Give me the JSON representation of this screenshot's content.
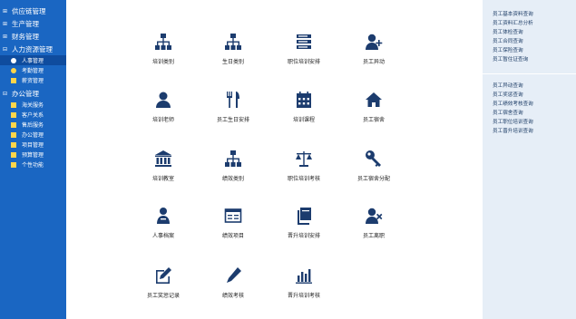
{
  "sidebar": {
    "top": [
      "供应链管理",
      "生产管理",
      "财务管理"
    ],
    "hr": {
      "label": "人力资源管理",
      "items": [
        "人事管理",
        "考勤管理",
        "薪资管理"
      ]
    },
    "office": {
      "label": "办公管理",
      "items": [
        "海关服务",
        "客户关系",
        "售后服务",
        "办公管理",
        "项目管理",
        "预算管理",
        "个性功能"
      ]
    }
  },
  "tiles": [
    {
      "label": "培训类别",
      "icon": "org-chart-icon"
    },
    {
      "label": "生日类别",
      "icon": "org-chart-icon"
    },
    {
      "label": "职位培训安排",
      "icon": "list-icon"
    },
    {
      "label": "员工异动",
      "icon": "user-add-icon"
    },
    {
      "label": "培训老师",
      "icon": "user-icon"
    },
    {
      "label": "员工生日安排",
      "icon": "cutlery-icon"
    },
    {
      "label": "培训课程",
      "icon": "calendar-icon"
    },
    {
      "label": "员工宿舍",
      "icon": "home-icon"
    },
    {
      "label": "培训教室",
      "icon": "bank-icon"
    },
    {
      "label": "绩效类别",
      "icon": "org-chart-icon"
    },
    {
      "label": "职位培训考核",
      "icon": "scale-icon"
    },
    {
      "label": "员工宿舍分配",
      "icon": "key-icon"
    },
    {
      "label": "人事档案",
      "icon": "archive-user-icon"
    },
    {
      "label": "绩效项目",
      "icon": "card-icon"
    },
    {
      "label": "晋升培训安排",
      "icon": "book-icon"
    },
    {
      "label": "员工离职",
      "icon": "user-remove-icon"
    },
    {
      "label": "员工奖惩记录",
      "icon": "edit-icon"
    },
    {
      "label": "绩效考核",
      "icon": "pencil-icon"
    },
    {
      "label": "晋升培训考核",
      "icon": "bar-chart-icon"
    }
  ],
  "right_panel": {
    "group1": [
      "员工基本资料查询",
      "员工资料汇总分析",
      "员工体检查询",
      "员工合同查询",
      "员工保险查询",
      "员工暂住证查询"
    ],
    "group2": [
      "员工异动查询",
      "员工奖惩查询",
      "员工绩效考核查询",
      "员工宿舍查询",
      "员工职位培训查询",
      "员工晋升培训查询"
    ]
  },
  "colors": {
    "sidebar": "#1a66c2",
    "icon": "#1c3c6e",
    "panel": "#e6eef7"
  }
}
